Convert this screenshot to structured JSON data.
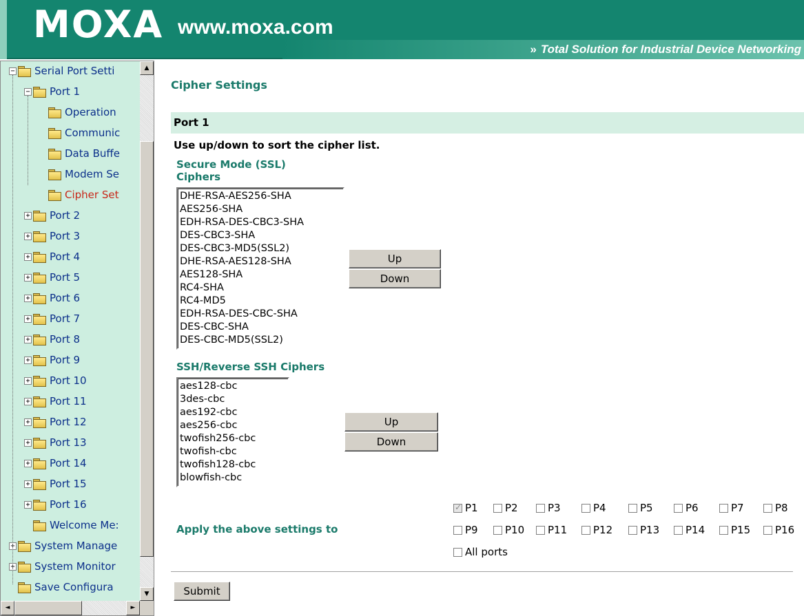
{
  "header": {
    "logo": "MOXA",
    "url": "www.moxa.com",
    "tagline_arrow": "»",
    "tagline": "Total Solution for Industrial Device Networking"
  },
  "tree": {
    "items": [
      {
        "label": "Serial Port Setti",
        "expander": "−",
        "open": true
      },
      {
        "label": "Port 1",
        "expander": "−",
        "open": true
      },
      {
        "label": "Operation"
      },
      {
        "label": "Communic"
      },
      {
        "label": "Data Buffe"
      },
      {
        "label": "Modem Se"
      },
      {
        "label": "Cipher Set",
        "active": true
      },
      {
        "label": "Port 2",
        "expander": "+"
      },
      {
        "label": "Port 3",
        "expander": "+"
      },
      {
        "label": "Port 4",
        "expander": "+"
      },
      {
        "label": "Port 5",
        "expander": "+"
      },
      {
        "label": "Port 6",
        "expander": "+"
      },
      {
        "label": "Port 7",
        "expander": "+"
      },
      {
        "label": "Port 8",
        "expander": "+"
      },
      {
        "label": "Port 9",
        "expander": "+"
      },
      {
        "label": "Port 10",
        "expander": "+"
      },
      {
        "label": "Port 11",
        "expander": "+"
      },
      {
        "label": "Port 12",
        "expander": "+"
      },
      {
        "label": "Port 13",
        "expander": "+"
      },
      {
        "label": "Port 14",
        "expander": "+"
      },
      {
        "label": "Port 15",
        "expander": "+"
      },
      {
        "label": "Port 16",
        "expander": "+"
      },
      {
        "label": "Welcome Me:"
      },
      {
        "label": "System Manage",
        "expander": "+"
      },
      {
        "label": "System Monitor",
        "expander": "+"
      },
      {
        "label": "Save Configura"
      }
    ],
    "scroll_up": "▲",
    "scroll_down": "▼",
    "scroll_left": "◄",
    "scroll_right": "►"
  },
  "main": {
    "title": "Cipher Settings",
    "port_bar": "Port 1",
    "instruction": "Use up/down to sort the cipher list.",
    "ssl": {
      "title_line1": "Secure Mode (SSL)",
      "title_line2": "Ciphers",
      "ciphers": [
        "DHE-RSA-AES256-SHA",
        "AES256-SHA",
        "EDH-RSA-DES-CBC3-SHA",
        "DES-CBC3-SHA",
        "DES-CBC3-MD5(SSL2)",
        "DHE-RSA-AES128-SHA",
        "AES128-SHA",
        "RC4-SHA",
        "RC4-MD5",
        "EDH-RSA-DES-CBC-SHA",
        "DES-CBC-SHA",
        "DES-CBC-MD5(SSL2)"
      ],
      "up_label": "Up",
      "down_label": "Down"
    },
    "ssh": {
      "title": "SSH/Reverse SSH Ciphers",
      "ciphers": [
        "aes128-cbc",
        "3des-cbc",
        "aes192-cbc",
        "aes256-cbc",
        "twofish256-cbc",
        "twofish-cbc",
        "twofish128-cbc",
        "blowfish-cbc"
      ],
      "up_label": "Up",
      "down_label": "Down"
    },
    "apply": {
      "label": "Apply the above settings to",
      "ports": [
        {
          "label": "P1",
          "checked": true,
          "disabled": true
        },
        {
          "label": "P2"
        },
        {
          "label": "P3"
        },
        {
          "label": "P4"
        },
        {
          "label": "P5"
        },
        {
          "label": "P6"
        },
        {
          "label": "P7"
        },
        {
          "label": "P8"
        },
        {
          "label": "P9"
        },
        {
          "label": "P10"
        },
        {
          "label": "P11"
        },
        {
          "label": "P12"
        },
        {
          "label": "P13"
        },
        {
          "label": "P14"
        },
        {
          "label": "P15"
        },
        {
          "label": "P16"
        }
      ],
      "all_ports_label": "All ports"
    },
    "submit_label": "Submit"
  },
  "colors": {
    "header_bg": "#14856f",
    "tree_bg": "#cdeee0",
    "section_title": "#1a7a6a",
    "port_bar_bg": "#d5efe3",
    "tree_link": "#0b2f8a",
    "tree_active": "#c8281a"
  }
}
